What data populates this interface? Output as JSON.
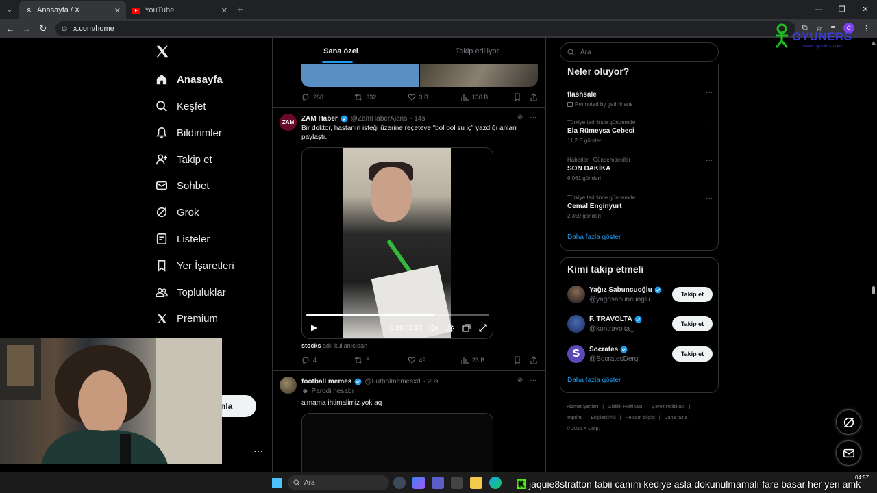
{
  "browser": {
    "tabs": [
      {
        "title": "Anasayfa / X",
        "active": true
      },
      {
        "title": "YouTube",
        "active": false
      }
    ],
    "url": "x.com/home",
    "profile_initial": "C"
  },
  "watermark": {
    "name": "OYUNERS",
    "sub": "www.oyuners.com"
  },
  "nav": {
    "items": [
      {
        "label": "Anasayfa"
      },
      {
        "label": "Keşfet"
      },
      {
        "label": "Bildirimler"
      },
      {
        "label": "Takip et"
      },
      {
        "label": "Sohbet"
      },
      {
        "label": "Grok"
      },
      {
        "label": "Listeler"
      },
      {
        "label": "Yer İşaretleri"
      },
      {
        "label": "Topluluklar"
      },
      {
        "label": "Premium"
      }
    ],
    "post_button": "nla",
    "more": "···"
  },
  "feed": {
    "tabs": [
      "Sana özel",
      "Takip ediliyor"
    ],
    "prev_actions": {
      "reply": "268",
      "repost": "332",
      "like": "3 B",
      "views": "130 B"
    },
    "post1": {
      "avatar_text": "ZAM",
      "name": "ZAM Haber",
      "handle": "@ZamHaberAjans",
      "time": "· 14s",
      "text": "Bir doktor, hastanın isteği üzerine reçeteye “bol bol su iç” yazdığı anları paylaştı.",
      "video_time": "0:19 / 0:27",
      "progress": 0.7,
      "from_user": "stocks",
      "from_suffix": "adlı kullanıcıdan",
      "actions": {
        "reply": "4",
        "repost": "5",
        "like": "49",
        "views": "23 B"
      }
    },
    "post2": {
      "name": "football memes",
      "handle": "@Futbolmemesxd",
      "time": "· 20s",
      "parody": "Parodi hesabı",
      "text": "almama ihtimalimiz yok aq"
    }
  },
  "right": {
    "search_placeholder": "Ara",
    "trends_title": "Neler oluyor?",
    "trends": [
      {
        "context": "",
        "title": "flashsale",
        "count": "Promoted by getirfinans",
        "promoted": true
      },
      {
        "context": "Türkiye tarihinde gündemde",
        "title": "Ela Rümeysa Cebeci",
        "count": "11,2 B gönderi"
      },
      {
        "context": "Haberler · Gündemdekiler",
        "title": "SON DAKİKA",
        "count": "6.061 gönderi"
      },
      {
        "context": "Türkiye tarihinde gündemde",
        "title": "Cemal Enginyurt",
        "count": "2.359 gönderi"
      }
    ],
    "show_more": "Daha fazla göster",
    "who_title": "Kimi takip etmeli",
    "who": [
      {
        "name": "Yağız Sabuncuoğlu",
        "handle": "@yagosabuncuoglu",
        "button": "Takip et"
      },
      {
        "name": "F. TRAVOLTA",
        "handle": "@kontravolta_",
        "button": "Takip et"
      },
      {
        "name": "Socrates",
        "handle": "@SocratesDergi",
        "button": "Takip et"
      }
    ],
    "who_show_more": "Daha fazla göster",
    "footer": [
      "Hizmet Şartları",
      "|",
      "Gizlilik Politikası",
      "|",
      "Çerez Politikası",
      "|",
      "Imprint",
      "|",
      "Erişilebilirlik",
      "|",
      "Reklam bilgisi",
      "|",
      "Daha fazla ···",
      "© 2026 X Corp."
    ]
  },
  "taskbar": {
    "search": "Ara",
    "clock": "04:57",
    "ticker_user": "jaquie8stratton",
    "ticker_text": "tabii canım kediye asla dokunulmamalı fare basar her yeri amk"
  },
  "colors": {
    "accent": "#1d9bf0",
    "bg": "#000000",
    "border": "#2f3336",
    "muted": "#71767b"
  }
}
